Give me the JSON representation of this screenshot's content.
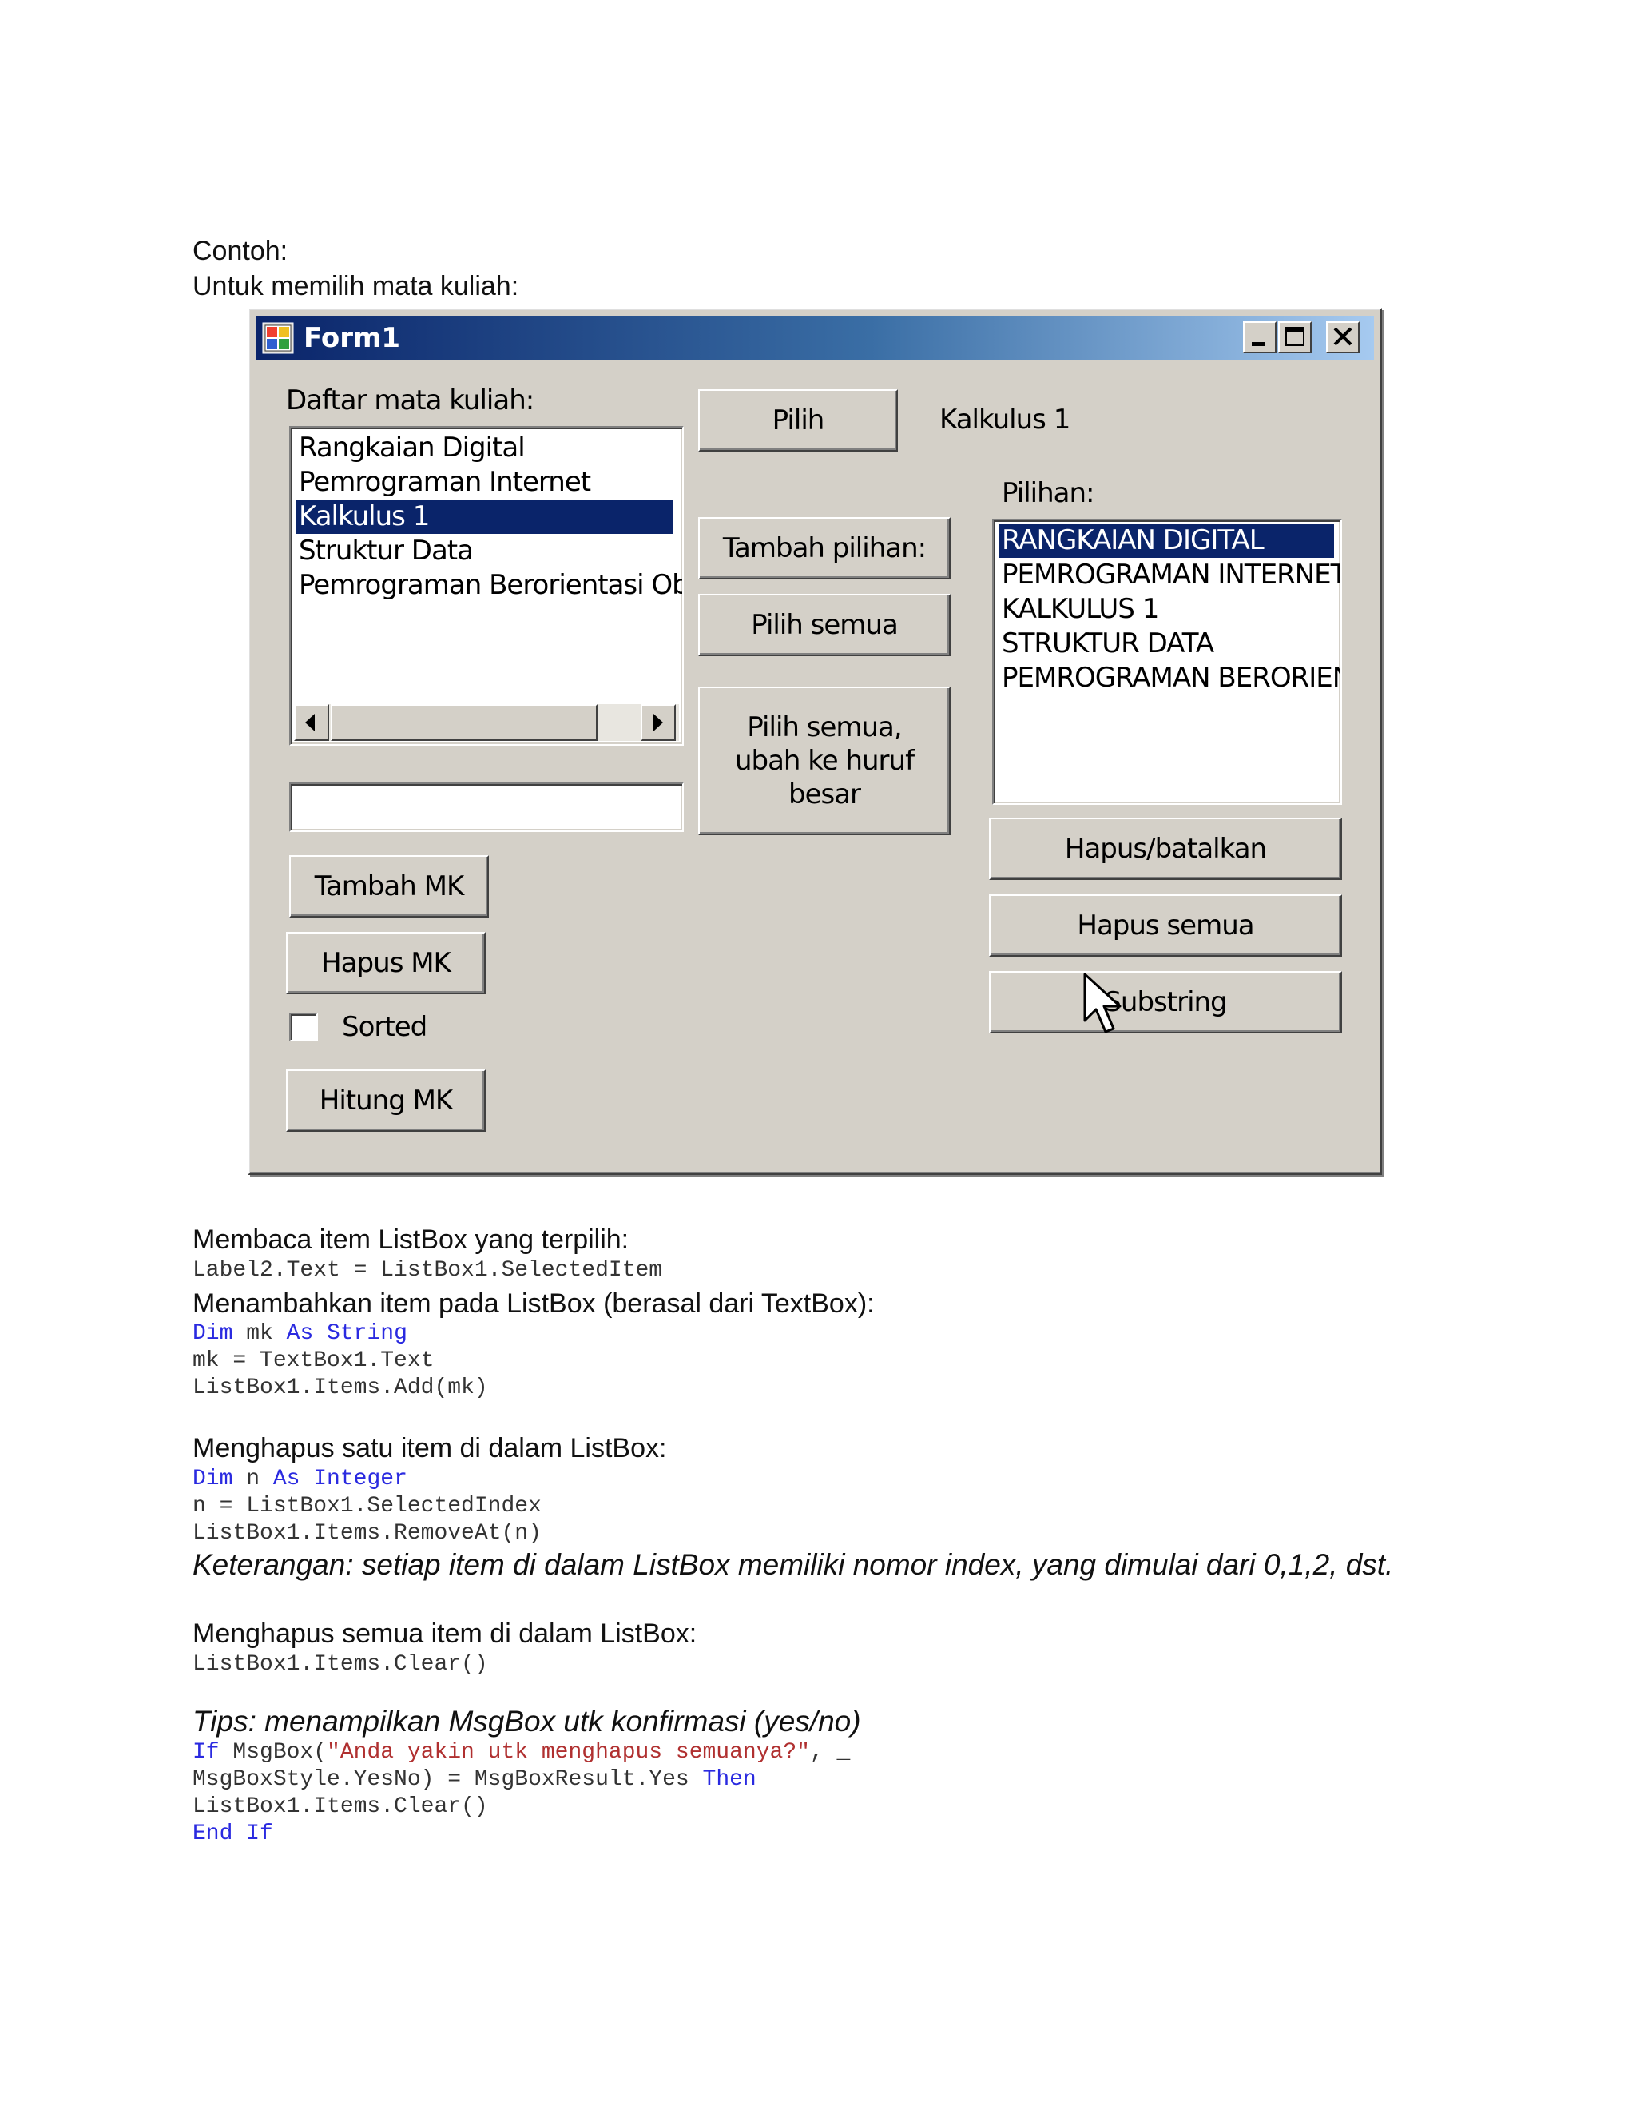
{
  "doc": {
    "intro_label": "Contoh:",
    "intro_sentence": "Untuk memilih mata kuliah:",
    "sec_read_heading": "Membaca item ListBox yang terpilih:",
    "sec_read_code": "Label2.Text = ListBox1.SelectedItem",
    "sec_add_heading": "Menambahkan item pada ListBox (berasal dari TextBox):",
    "sec_add_code": {
      "l1_kw1": "Dim",
      "l1_mid": " mk ",
      "l1_kw2": "As String",
      "l2": "mk = TextBox1.Text",
      "l3": "ListBox1.Items.Add(mk)"
    },
    "sec_remove_heading": "Menghapus satu item di dalam ListBox:",
    "sec_remove_code": {
      "l1_kw1": "Dim",
      "l1_mid": " n ",
      "l1_kw2": "As Integer",
      "l2": "n = ListBox1.SelectedIndex",
      "l3": "ListBox1.Items.RemoveAt(n)"
    },
    "remove_note": "Keterangan: setiap item di dalam ListBox memiliki nomor index, yang dimulai dari 0,1,2, dst.",
    "sec_clear_heading": "Menghapus semua item di dalam ListBox:",
    "sec_clear_code": "ListBox1.Items.Clear()",
    "tips_heading": "Tips: menampilkan MsgBox utk konfirmasi (yes/no)",
    "tips_code": {
      "l1_kw": "If",
      "l1_a": " MsgBox(",
      "l1_str": "\"Anda yakin utk menghapus semuanya?\"",
      "l1_b": ", _",
      "l2_a": "MsgBoxStyle.YesNo) = MsgBoxResult.Yes ",
      "l2_kw": "Then",
      "l3": "ListBox1.Items.Clear()",
      "l4_kw": "End If"
    }
  },
  "form": {
    "title": "Form1",
    "titlebar_buttons": [
      "minimize-icon",
      "maximize-icon",
      "close-icon"
    ],
    "left_list_label": "Daftar mata kuliah:",
    "left_list_items": [
      "Rangkaian Digital",
      "Pemrograman Internet",
      "Kalkulus 1",
      "Struktur Data",
      "Pemrograman Berorientasi Obj"
    ],
    "left_list_selected_index": 2,
    "textbox_value": "",
    "btn_tambah_mk": "Tambah MK",
    "btn_hapus_mk": "Hapus MK",
    "checkbox_sorted_label": "Sorted",
    "checkbox_sorted_checked": false,
    "btn_hitung_mk": "Hitung MK",
    "btn_pilih": "Pilih",
    "selected_value_label": "Kalkulus 1",
    "btn_tambah_pilihan": "Tambah pilihan:",
    "btn_pilih_semua": "Pilih semua",
    "btn_pilih_semua_upper": "Pilih semua, ubah ke huruf besar",
    "right_list_label": "Pilihan:",
    "right_list_items": [
      "RANGKAIAN DIGITAL",
      "PEMROGRAMAN INTERNET",
      "KALKULUS 1",
      "STRUKTUR DATA",
      "PEMROGRAMAN BERORIENTASI OBJEK"
    ],
    "right_list_selected_index": 0,
    "btn_hapus_batalkan": "Hapus/batalkan",
    "btn_hapus_semua": "Hapus semua",
    "btn_substring": "Substring"
  }
}
